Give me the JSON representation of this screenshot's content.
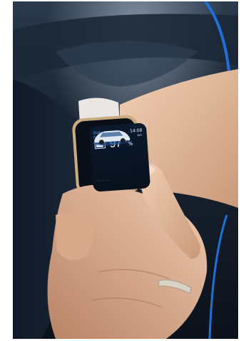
{
  "watch": {
    "screen_title": "State",
    "screen_subtitle": "Autonomia",
    "time": "14:08",
    "range_label": "km",
    "battery_value": "97",
    "battery_unit": "%",
    "battery_level": 0.97,
    "footer": "……………"
  },
  "colors": {
    "screen_accent": "#4fa8ff",
    "seat_trim": "#1e6fd9",
    "skin": "#e8c3a6",
    "strap": "#e8e7e3",
    "watch_case": "#c8ab7e"
  }
}
